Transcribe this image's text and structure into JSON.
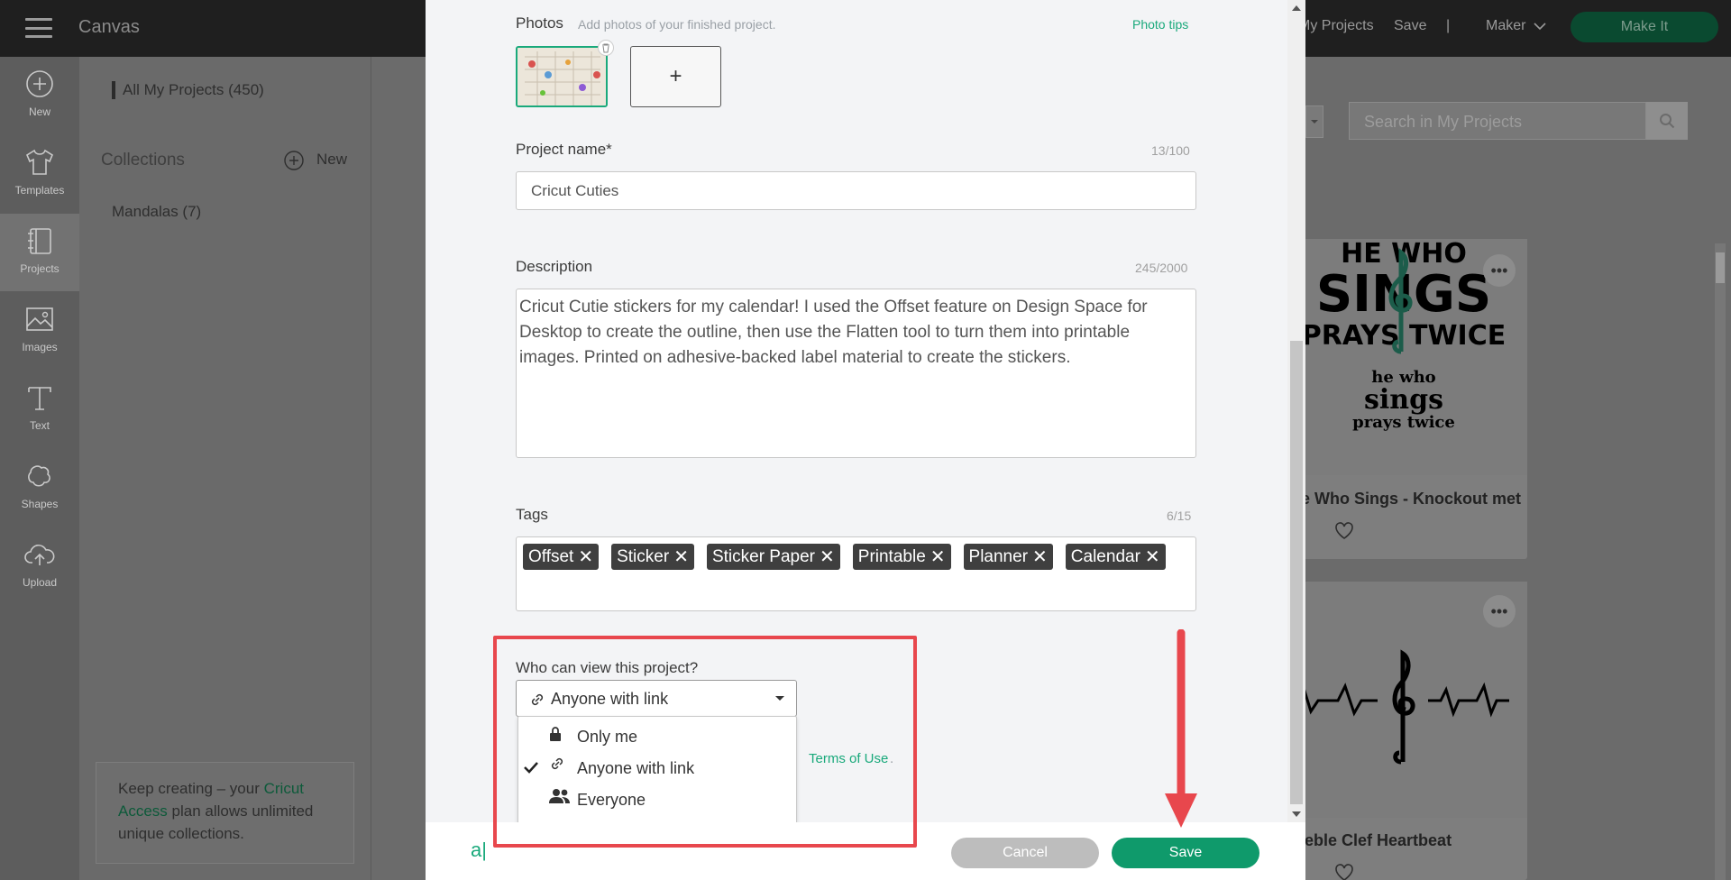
{
  "app": {
    "title": "Canvas"
  },
  "topbar": {
    "my_projects": "My Projects",
    "save": "Save",
    "divider": "|",
    "machine": "Maker",
    "make_it": "Make It"
  },
  "rail": [
    {
      "label": "New",
      "icon": "plus-circle-icon"
    },
    {
      "label": "Templates",
      "icon": "tshirt-icon"
    },
    {
      "label": "Projects",
      "icon": "projects-icon"
    },
    {
      "label": "Images",
      "icon": "image-icon"
    },
    {
      "label": "Text",
      "icon": "text-icon"
    },
    {
      "label": "Shapes",
      "icon": "shapes-icon"
    },
    {
      "label": "Upload",
      "icon": "cloud-upload-icon"
    }
  ],
  "left_panel": {
    "all_projects": "All My Projects (450)",
    "collections": "Collections",
    "new": "New",
    "collection_item": "Mandalas (7)",
    "promo_pre": "Keep creating – your ",
    "promo_link": "Cricut Access",
    "promo_post": " plan allows unlimited unique collections."
  },
  "search": {
    "placeholder": "Search in My Projects"
  },
  "cards": [
    {
      "title": "He Who Sings - Knockout met...",
      "art_line1": "HE WHO",
      "art_line2": "SINGS",
      "art_line3": "PRAYS TWICE",
      "art_small1": "he who",
      "art_small2": "sings",
      "art_small3": "prays twice"
    },
    {
      "title": "Treble Clef Heartbeat"
    }
  ],
  "modal": {
    "photos_label": "Photos",
    "photos_hint": "Add photos of your finished project.",
    "photo_tips": "Photo tips",
    "add_photo": "+",
    "name_label": "Project name*",
    "name_counter": "13/100",
    "name_value": "Cricut Cuties",
    "desc_label": "Description",
    "desc_counter": "245/2000",
    "desc_value": "Cricut Cutie stickers for my calendar!  I used the Offset feature on Design Space for Desktop to create the outline, then use the Flatten tool to turn them into printable images. Printed on adhesive-backed label material to create the stickers.",
    "tags_label": "Tags",
    "tags_counter": "6/15",
    "tags": [
      "Offset",
      "Sticker",
      "Sticker Paper",
      "Printable",
      "Planner",
      "Calendar"
    ],
    "tag_remove": "✕",
    "visibility_label": "Who can view this project?",
    "visibility_selected": "Anyone with link",
    "visibility_options": [
      "Only me",
      "Anyone with link",
      "Everyone"
    ],
    "terms_partial": "s ",
    "terms_link": "Terms of Use",
    "terms_end": ".",
    "footer_mark": "a|",
    "cancel": "Cancel",
    "save": "Save"
  },
  "colors": {
    "accent": "#19a97b",
    "annotation": "#e8474d",
    "tag_bg": "#3f3f3f"
  }
}
